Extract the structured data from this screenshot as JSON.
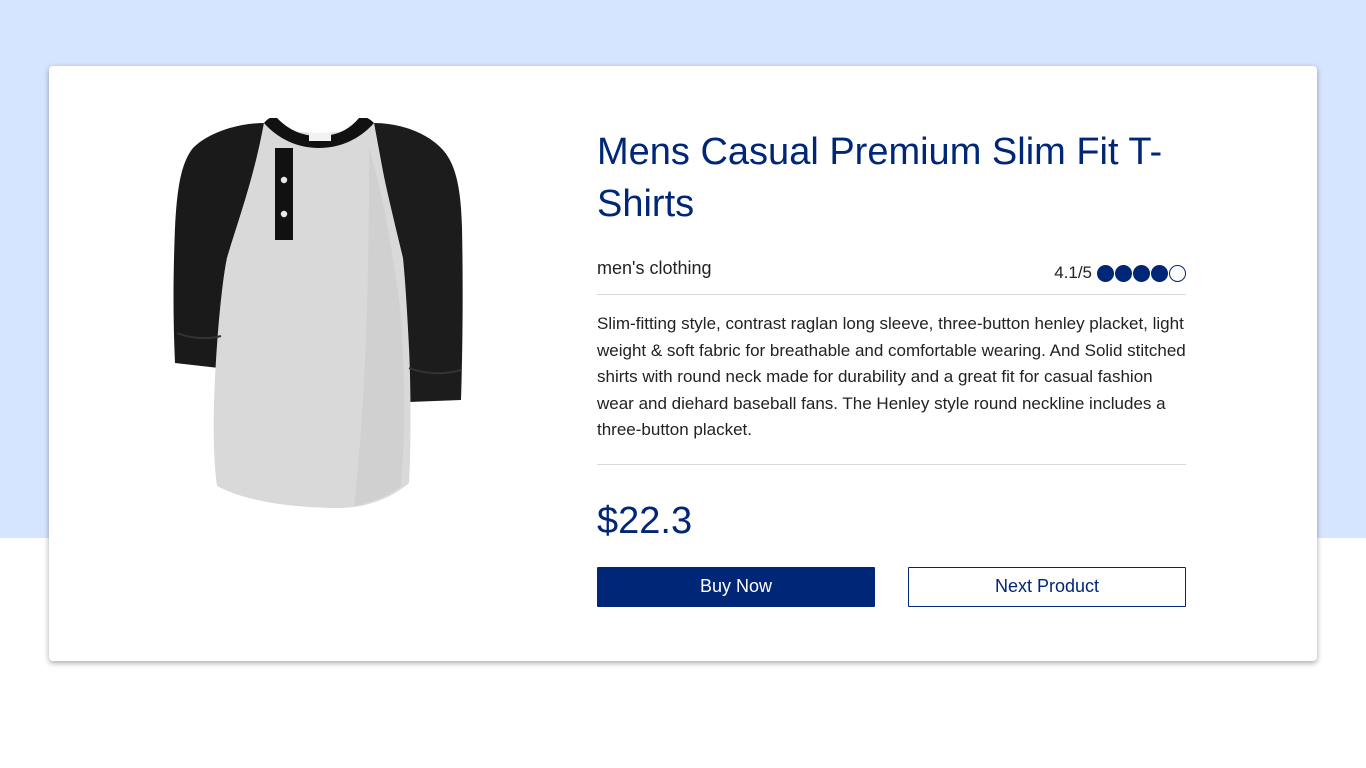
{
  "product": {
    "title": "Mens Casual Premium Slim Fit T-Shirts",
    "category": "men's clothing",
    "rating_text": "4.1/5",
    "rating": 4.1,
    "rating_max": 5,
    "rating_dots": [
      "filled",
      "filled",
      "filled",
      "filled",
      "empty"
    ],
    "description": "Slim-fitting style, contrast raglan long sleeve, three-button henley placket, light weight & soft fabric for breathable and comfortable wearing. And Solid stitched shirts with round neck made for durability and a great fit for casual fashion wear and diehard baseball fans. The Henley style round neckline includes a three-button placket.",
    "price": "$22.3",
    "image": "raglan-henley-tshirt-image"
  },
  "actions": {
    "buy_label": "Buy Now",
    "next_label": "Next Product"
  },
  "colors": {
    "accent": "#002677",
    "page_background": "#d6e5ff",
    "card_background": "#ffffff"
  }
}
